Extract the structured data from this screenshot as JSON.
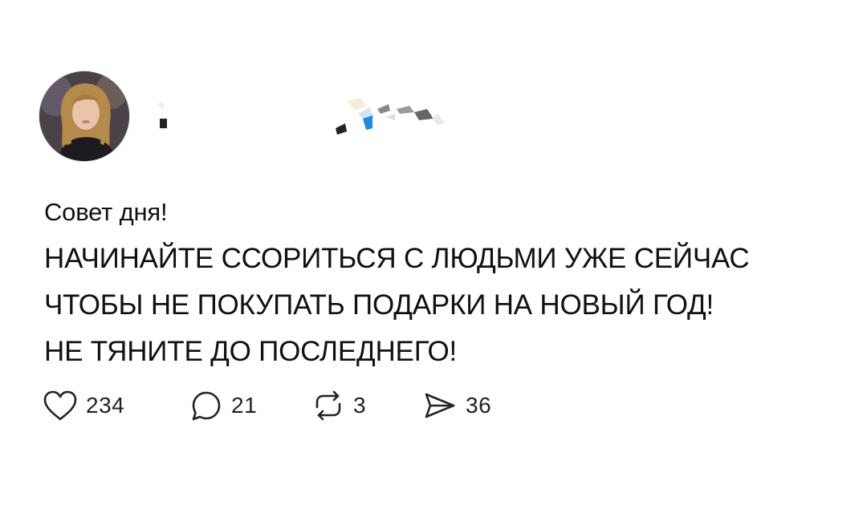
{
  "post": {
    "author": {
      "avatar_icon": "profile-photo",
      "username_redacted": true
    },
    "text_lines": [
      "Совет дня!",
      "НАЧИНАЙТЕ ССОРИТЬСЯ С ЛЮДЬМИ УЖЕ СЕЙЧАС",
      "ЧТОБЫ НЕ ПОКУПАТЬ ПОДАРКИ НА НОВЫЙ ГОД!",
      "НЕ ТЯНИТЕ ДО ПОСЛЕДНЕГО!"
    ],
    "actions": {
      "likes": {
        "icon": "heart-icon",
        "count": "234"
      },
      "replies": {
        "icon": "comment-icon",
        "count": "21"
      },
      "reposts": {
        "icon": "repost-icon",
        "count": "3"
      },
      "shares": {
        "icon": "send-icon",
        "count": "36"
      }
    }
  },
  "colors": {
    "background": "#ffffff",
    "text": "#111111",
    "redaction_blue": "#1e88e5"
  }
}
